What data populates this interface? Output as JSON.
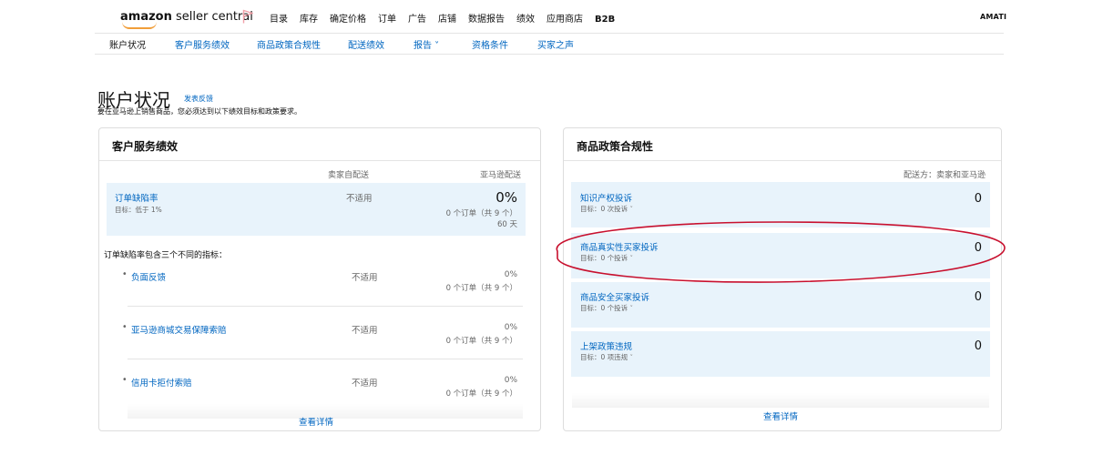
{
  "header": {
    "logo_brand": "amazon",
    "logo_product": "seller central",
    "nav": [
      "目录",
      "库存",
      "确定价格",
      "订单",
      "广告",
      "店铺",
      "数据报告",
      "绩效",
      "应用商店",
      "B2B"
    ],
    "user": "AMATI"
  },
  "subnav": {
    "items": [
      "账户状况",
      "客户服务绩效",
      "商品政策合规性",
      "配送绩效",
      "报告 ˅",
      "资格条件",
      "买家之声"
    ]
  },
  "page": {
    "title": "账户状况",
    "feedback": "发表反馈",
    "intro": "要在亚马逊上销售商品，您必须达到以下绩效目标和政策要求。"
  },
  "left_panel": {
    "title": "客户服务绩效",
    "col_seller": "卖家自配送",
    "col_amazon": "亚马逊配送",
    "main_metric": {
      "label": "订单缺陷率",
      "target": "目标：低于 1%",
      "seller_value": "不适用",
      "amazon_value": "0%",
      "amazon_orders": "0 个订单（共 9 个）",
      "amazon_period": "60 天"
    },
    "description": "订单缺陷率包含三个不同的指标：",
    "sub_metrics": [
      {
        "label": "负面反馈",
        "seller_value": "不适用",
        "amazon_value": "0%",
        "amazon_orders": "0 个订单（共 9 个）"
      },
      {
        "label": "亚马逊商城交易保障索赔",
        "seller_value": "不适用",
        "amazon_value": "0%",
        "amazon_orders": "0 个订单（共 9 个）"
      },
      {
        "label": "信用卡拒付索赔",
        "seller_value": "不适用",
        "amazon_value": "0%",
        "amazon_orders": "0 个订单（共 9 个）"
      }
    ],
    "details_link": "查看详情"
  },
  "right_panel": {
    "title": "商品政策合规性",
    "shipped_by": "配送方：卖家和亚马逊",
    "items": [
      {
        "label": "知识产权投诉",
        "target": "目标：0 次投诉",
        "value": "0"
      },
      {
        "label": "商品真实性买家投诉",
        "target": "目标：0 个投诉",
        "value": "0"
      },
      {
        "label": "商品安全买家投诉",
        "target": "目标：0 个投诉",
        "value": "0"
      },
      {
        "label": "上架政策违规",
        "target": "目标：0 项违规",
        "value": "0"
      }
    ],
    "details_link": "查看详情"
  },
  "colors": {
    "link": "#0066c0",
    "highlight_row": "#e8f3fb",
    "annotation_ellipse": "#c8102e",
    "logo_smile": "#f19e39"
  }
}
